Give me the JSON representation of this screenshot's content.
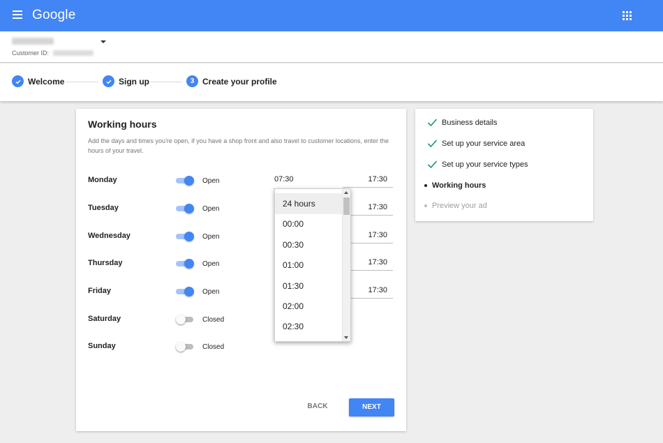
{
  "app": {
    "logo_text": "Google"
  },
  "account": {
    "customer_id_label": "Customer ID:"
  },
  "stepper": {
    "steps": [
      {
        "label": "Welcome",
        "state": "done"
      },
      {
        "label": "Sign up",
        "state": "done"
      },
      {
        "label": "Create your profile",
        "state": "current",
        "number": "3"
      }
    ]
  },
  "working_hours": {
    "title": "Working hours",
    "description": "Add the days and times you're open, if you have a shop front and also travel to customer locations, enter the hours of your travel.",
    "open_time": "07:30",
    "close_time": "17:30",
    "days": [
      {
        "name": "Monday",
        "status": "Open",
        "on": true
      },
      {
        "name": "Tuesday",
        "status": "Open",
        "on": true
      },
      {
        "name": "Wednesday",
        "status": "Open",
        "on": true
      },
      {
        "name": "Thursday",
        "status": "Open",
        "on": true
      },
      {
        "name": "Friday",
        "status": "Open",
        "on": true
      },
      {
        "name": "Saturday",
        "status": "Closed",
        "on": false
      },
      {
        "name": "Sunday",
        "status": "Closed",
        "on": false
      }
    ],
    "back_label": "BACK",
    "next_label": "NEXT"
  },
  "time_dropdown": {
    "options": [
      "24 hours",
      "00:00",
      "00:30",
      "01:00",
      "01:30",
      "02:00",
      "02:30"
    ],
    "selected": "24 hours"
  },
  "progress": {
    "items": [
      {
        "label": "Business details",
        "state": "done",
        "icon": "check-icon"
      },
      {
        "label": "Set up your service area",
        "state": "done",
        "icon": "check-icon"
      },
      {
        "label": "Set up your service types",
        "state": "done",
        "icon": "check-icon"
      },
      {
        "label": "Working hours",
        "state": "current",
        "icon": "dot-icon"
      },
      {
        "label": "Preview your ad",
        "state": "pending",
        "icon": "dot-icon"
      }
    ]
  },
  "colors": {
    "brand": "#4285f4",
    "check": "#0f9d58"
  }
}
